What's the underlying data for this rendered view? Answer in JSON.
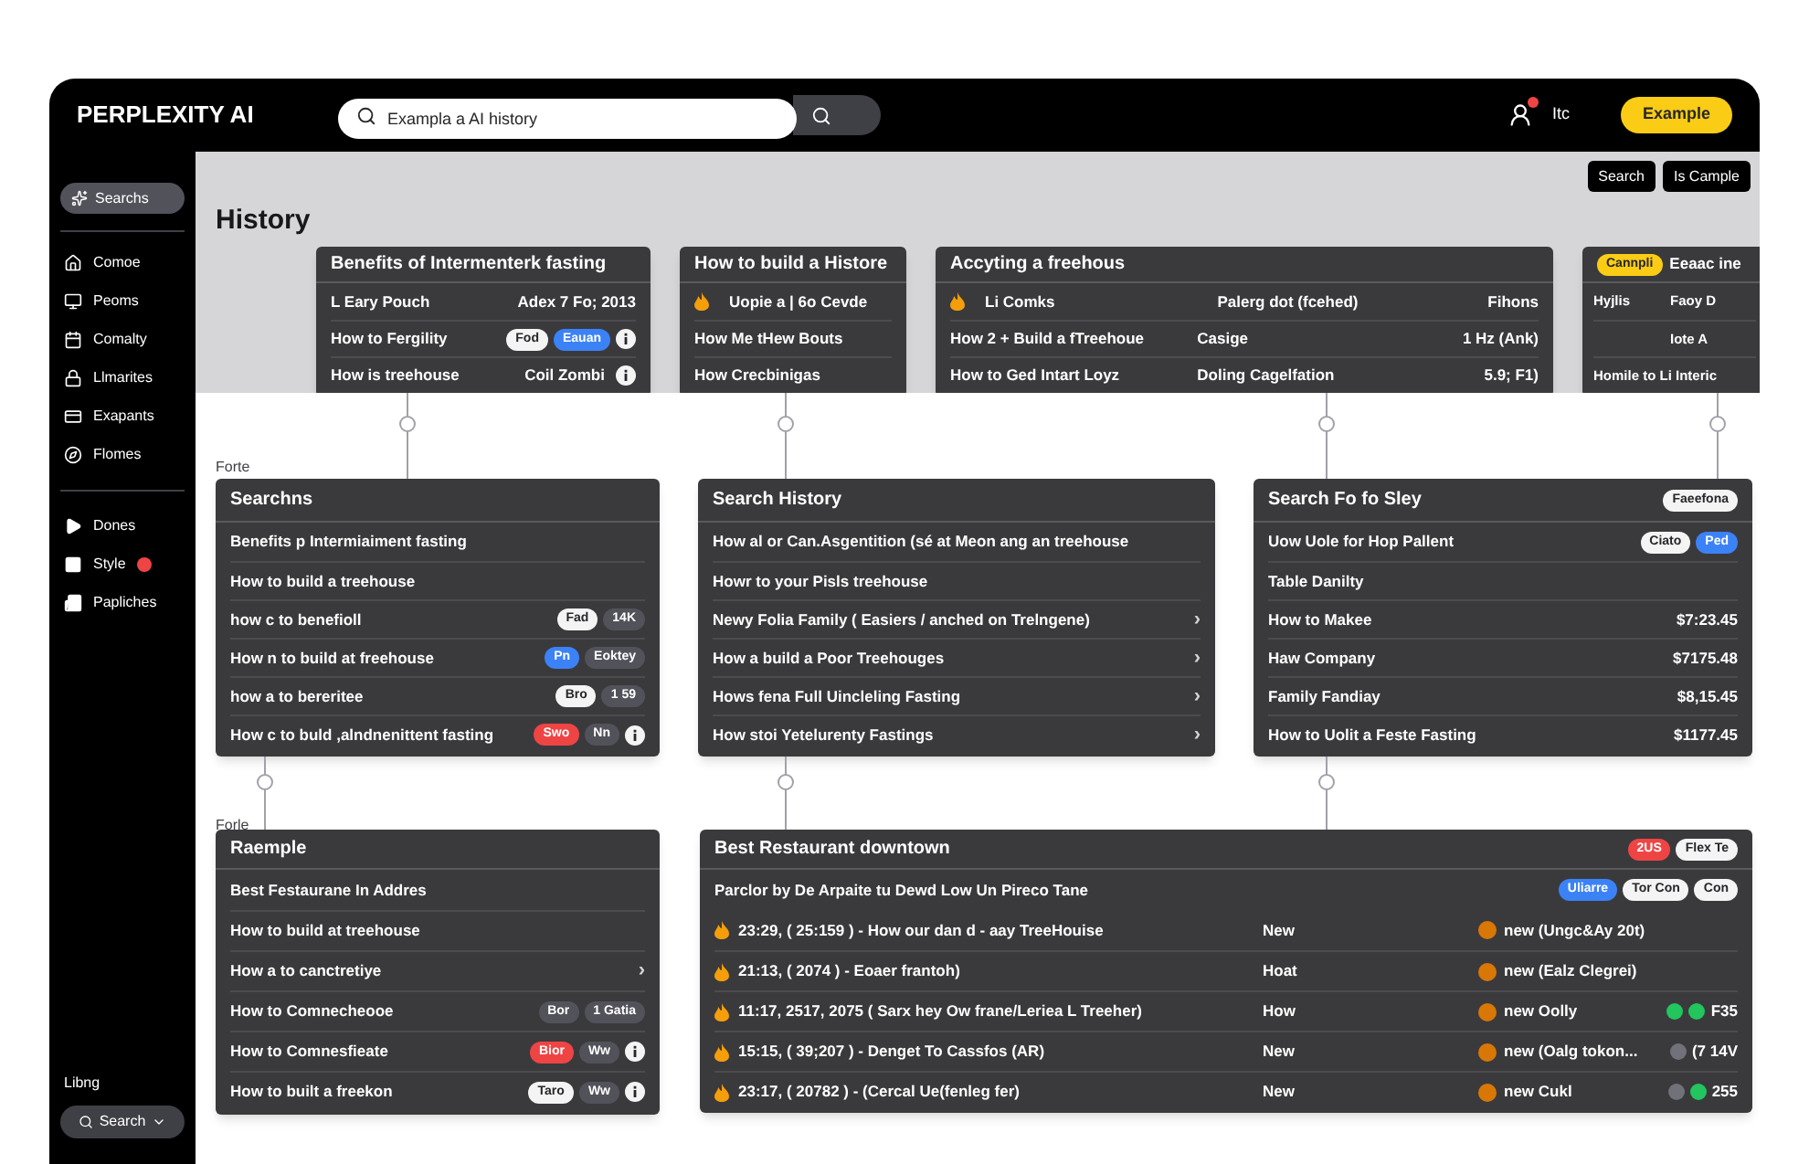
{
  "header": {
    "logo": "PERPLEXITY AI",
    "search_value": "Exampla a AI history",
    "user_label": "Itc",
    "button": "Example"
  },
  "sidebar": {
    "top": {
      "label": "Searchs",
      "selected": true
    },
    "items": [
      {
        "label": "Comoe",
        "selected": false
      },
      {
        "label": "Peoms",
        "selected": false
      },
      {
        "label": "Comalty",
        "selected": false
      },
      {
        "label": "Llmarites",
        "selected": false
      },
      {
        "label": "Exapants",
        "selected": false
      },
      {
        "label": "Flomes",
        "selected": false
      }
    ],
    "group2": [
      {
        "label": "Dones",
        "alert": false
      },
      {
        "label": "Style",
        "alert": true
      },
      {
        "label": "Papliches",
        "alert": false
      }
    ],
    "footer_label": "Libng",
    "footer_button": "Search"
  },
  "page": {
    "title": "History",
    "actions": [
      "Search",
      "Is Cample"
    ]
  },
  "row_1": [
    {
      "title": "Benefits of Intermenterk fasting",
      "rows": [
        {
          "cells": [
            "L Eary Pouch",
            "Adex 7 Fo; 2013"
          ]
        },
        {
          "cells": [
            "How to Fergility"
          ],
          "badges": [
            {
              "kind": "pill",
              "text": "Fod",
              "color": "#f4f4f5"
            },
            {
              "kind": "pill",
              "text": "Eauan",
              "color": "#3b82f6"
            },
            {
              "kind": "info"
            }
          ]
        },
        {
          "cells": [
            "How is treehouse",
            "Coil Zombi"
          ],
          "badges": [
            {
              "kind": "info"
            }
          ]
        }
      ]
    },
    {
      "title": "How to build a Histore",
      "rows": [
        {
          "kind": "marked",
          "cells": [
            "Uopie a | 6o Cevde"
          ]
        },
        {
          "kind": "plain",
          "cells": [
            "How Me tHew Bouts"
          ]
        },
        {
          "kind": "plain",
          "cells": [
            "How Crecbinigas"
          ]
        }
      ]
    },
    {
      "title": "Accyting a freehous",
      "rows": [
        {
          "kind": "marked",
          "cells": [
            "Li Comks",
            "Palerg dot (fcehed)",
            "Fihons"
          ]
        },
        {
          "kind": "plain",
          "cells": [
            "How 2 + Build a fTreehoue",
            "Casige",
            "1 Hz (Ank)"
          ]
        },
        {
          "kind": "plain",
          "cells": [
            "How to Ged Intart Loyz",
            "Doling Cagelfation",
            "5.9; F1)"
          ]
        }
      ]
    },
    {
      "title": "Eeaac ine",
      "lead_badge": {
        "text": "Cannpli",
        "color": "#facc15"
      },
      "rows": [
        {
          "kind": "plain",
          "cells": [
            "Hyjlis",
            "Faoy D"
          ]
        },
        {
          "kind": "indented",
          "cells": [
            "Iote A"
          ]
        },
        {
          "kind": "plain",
          "cells": [
            "Homile to Li Interic"
          ]
        }
      ]
    }
  ],
  "label_1": "Forte",
  "row_2": [
    {
      "title": "Searchns",
      "rows": [
        {
          "cells": [
            "Benefits p Intermiaiment fasting"
          ]
        },
        {
          "cells": [
            "How to build a treehouse"
          ]
        },
        {
          "cells": [
            "how c to benefioll"
          ],
          "badges": [
            {
              "kind": "pill",
              "text": "Fad",
              "color": "#f4f4f5"
            },
            {
              "kind": "pill",
              "text": "14K",
              "color": "#52525b"
            }
          ]
        },
        {
          "cells": [
            "How n to build at freehouse"
          ],
          "badges": [
            {
              "kind": "pill",
              "text": "Pn",
              "color": "#3b82f6"
            },
            {
              "kind": "pill",
              "text": "Eoktey",
              "color": "#52525b"
            }
          ]
        },
        {
          "cells": [
            "how a to bereritee"
          ],
          "badges": [
            {
              "kind": "pill",
              "text": "Bro",
              "color": "#f4f4f5"
            },
            {
              "kind": "pill",
              "text": "1 59",
              "color": "#52525b"
            }
          ]
        },
        {
          "cells": [
            "How c to buld ,alndnenittent fasting"
          ],
          "badges": [
            {
              "kind": "pill",
              "text": "Swo",
              "color": "#ef4444"
            },
            {
              "kind": "pill",
              "text": "Nn",
              "color": "#52525b"
            },
            {
              "kind": "info"
            }
          ]
        }
      ]
    },
    {
      "title": "Search History",
      "rows": [
        {
          "cells": [
            "How al or Can.Asgentition (sé at Meon ang an treehouse"
          ]
        },
        {
          "cells": [
            "Howr to your Pisls treehouse"
          ]
        },
        {
          "cells": [
            "Newy Folia Family ( Easiers / anched on Trelngene)"
          ],
          "arrow": "›"
        },
        {
          "cells": [
            "How a build a Poor Treehouges"
          ],
          "arrow": "›"
        },
        {
          "cells": [
            "Hows fena Full Uincleling Fasting"
          ],
          "arrow": "›"
        },
        {
          "cells": [
            "How stoi Yetelurenty Fastings"
          ],
          "arrow": "›"
        }
      ]
    },
    {
      "title": "Search Fo fo Sley",
      "header_badges": [
        {
          "kind": "pill",
          "text": "Faeefona",
          "color": "#f4f4f5"
        }
      ],
      "rows": [
        {
          "cells": [
            "Uow Uole for Hop Pallent"
          ],
          "badges": [
            {
              "kind": "pill",
              "text": "Ciato",
              "color": "#f4f4f5"
            },
            {
              "kind": "pill",
              "text": "Ped",
              "color": "#3b82f6"
            }
          ]
        },
        {
          "cells": [
            "Table Danilty"
          ]
        },
        {
          "cells": [
            "How to Makee",
            "$7:23.45"
          ]
        },
        {
          "cells": [
            "Haw Company",
            "$7175.48"
          ]
        },
        {
          "cells": [
            "Family Fandiay",
            "$8,15.45"
          ]
        },
        {
          "cells": [
            "How to Uolit a Feste Fasting",
            "$1177.45"
          ]
        }
      ]
    }
  ],
  "label_2": "Forle",
  "row_3_card": {
    "title": "Raemple",
    "rows": [
      {
        "cells": [
          "Best Festaurane In Addres"
        ]
      },
      {
        "cells": [
          "How to build at treehouse"
        ]
      },
      {
        "cells": [
          "How a to canctretiye"
        ],
        "arrow": "›"
      },
      {
        "cells": [
          "How to Comnecheooe"
        ],
        "badges": [
          {
            "kind": "pill",
            "text": "Bor",
            "color": "#52525b"
          },
          {
            "kind": "pill",
            "text": "1 Gatia",
            "color": "#52525b"
          }
        ]
      },
      {
        "cells": [
          "How to Comnesfieate"
        ],
        "badges": [
          {
            "kind": "pill",
            "text": "Bior",
            "color": "#ef4444"
          },
          {
            "kind": "pill",
            "text": "Ww",
            "color": "#52525b"
          },
          {
            "kind": "info"
          }
        ]
      },
      {
        "cells": [
          "How to built a freekon"
        ],
        "badges": [
          {
            "kind": "pill",
            "text": "Taro",
            "color": "#f4f4f5"
          },
          {
            "kind": "pill",
            "text": "Ww",
            "color": "#52525b"
          },
          {
            "kind": "info"
          }
        ]
      }
    ]
  },
  "restaurant": {
    "title": "Best Restaurant downtown",
    "header_badges": [
      {
        "kind": "pill",
        "text": "2US",
        "color": "#ef4444"
      },
      {
        "kind": "pill",
        "text": "Flex Te",
        "color": "#f4f4f5"
      }
    ],
    "subtitle": {
      "text": "Parclor by De Arpaite tu Dewd Low Un Pireco Tane",
      "badges": [
        {
          "kind": "pill",
          "text": "Uliarre",
          "color": "#3b82f6"
        },
        {
          "kind": "pill",
          "text": "Tor Con",
          "color": "#f4f4f5"
        },
        {
          "kind": "pill",
          "text": "Con",
          "color": "#f4f4f5"
        }
      ]
    },
    "rows": [
      {
        "cells": [
          "23:29, ( 25:159 ) - How our dan d - aay TreeHouise",
          "New",
          "new (Ungc&Ay 20t)"
        ]
      },
      {
        "cells": [
          "21:13, ( 2074 ) - Eoaer frantoh)",
          "Hoat",
          "new (Ealz Clegrei)"
        ]
      },
      {
        "cells": [
          "11:17, 2517, 2075 ( Sarx hey Ow frane/Leriea L Treeher)",
          "How",
          "new Oolly"
        ],
        "trail": {
          "dots": [
            {
              "color": "#22c55e"
            },
            {
              "color": "#22c55e"
            }
          ],
          "text": "F35"
        }
      },
      {
        "cells": [
          "15:15, ( 39;207 ) - Denget To Cassfos (AR)",
          "New",
          "new (Oalg tokon..."
        ],
        "trail": {
          "dots": [
            {
              "color": "#71717a"
            }
          ],
          "text": "(7 14V"
        }
      },
      {
        "cells": [
          "23:17, ( 20782 ) - (Cercal Ue(fenleg fer)",
          "New",
          "new Cukl"
        ],
        "trail": {
          "dots": [
            {
              "color": "#71717a"
            },
            {
              "color": "#22c55e"
            }
          ],
          "text": "255"
        }
      }
    ]
  }
}
